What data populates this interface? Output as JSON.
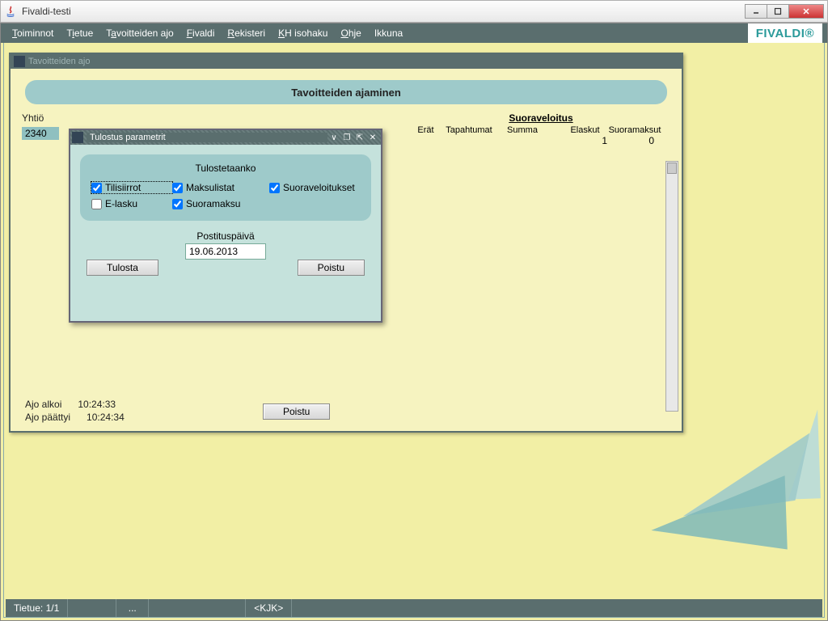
{
  "window": {
    "title": "Fivaldi-testi"
  },
  "menu": {
    "items": [
      "Toiminnot",
      "Tietue",
      "Tavoitteiden ajo",
      "Fivaldi",
      "Rekisteri",
      "KH isohaku",
      "Ohje",
      "Ikkuna"
    ]
  },
  "brand": "FIVALDI",
  "mdi": {
    "title": "Tavoitteiden ajo",
    "header": "Tavoitteiden ajaminen",
    "yhtio_label": "Yhtiö",
    "yhtio_value": "2340",
    "suoraveloitus": {
      "title": "Suoraveloitus",
      "cols": {
        "c1": "Erät",
        "c2": "Tapahtumat",
        "c3": "Summa",
        "c4": "Elaskut",
        "c5": "Suoramaksut"
      },
      "row": {
        "c1": "",
        "c2": "",
        "c3": "",
        "c4": "1",
        "c5": "0"
      }
    },
    "ajo_alkoi_label": "Ajo alkoi",
    "ajo_alkoi_value": "10:24:33",
    "ajo_paattyi_label": "Ajo päättyi",
    "ajo_paattyi_value": "10:24:34",
    "poistu": "Poistu"
  },
  "dialog": {
    "title": "Tulostus parametrit",
    "panel_title": "Tulostetaanko",
    "cb": {
      "tilisiirrot": "Tilisiirrot",
      "maksulistat": "Maksulistat",
      "suoraveloitukset": "Suoraveloitukset",
      "elasku": "E-lasku",
      "suoramaksu": "Suoramaksu"
    },
    "postituspaiva_label": "Postituspäivä",
    "postituspaiva_value": "19.06.2013",
    "tulosta": "Tulosta",
    "poistu": "Poistu"
  },
  "status": {
    "tietue": "Tietue: 1/1",
    "dots": "...",
    "user": "<KJK>"
  }
}
